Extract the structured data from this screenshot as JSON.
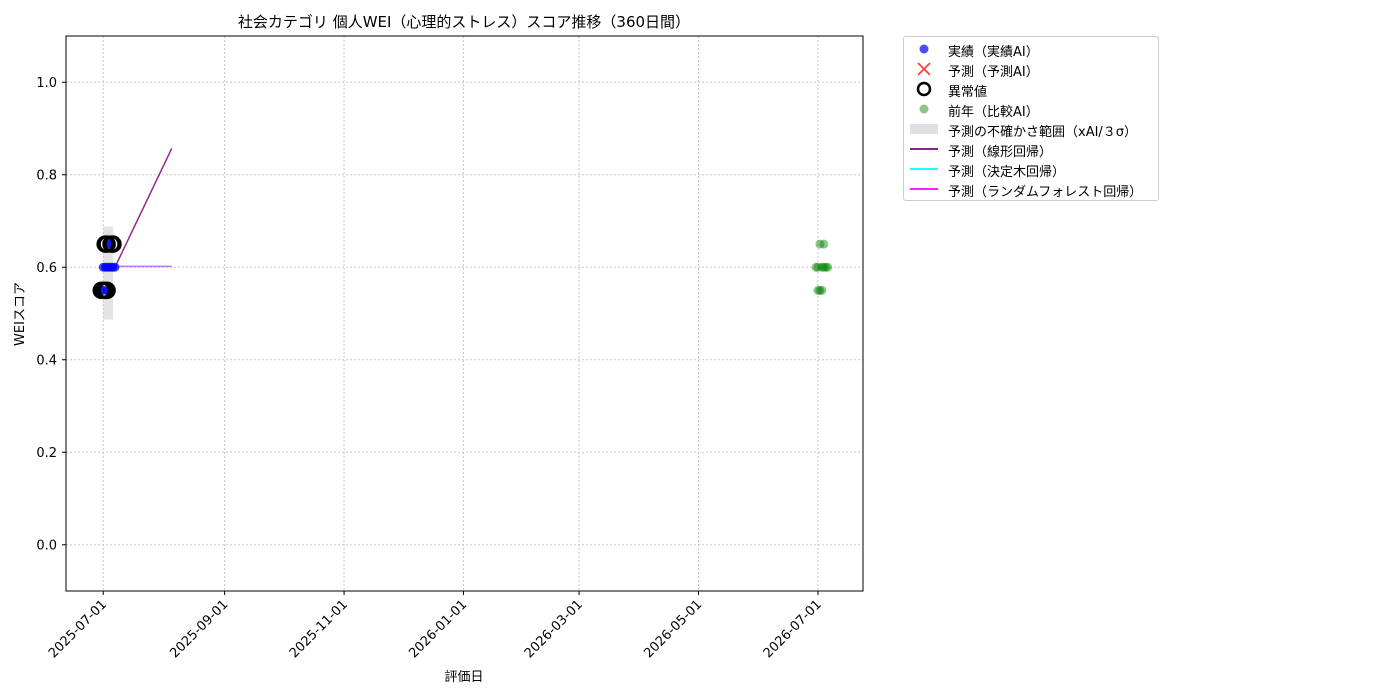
{
  "chart_data": {
    "type": "scatter",
    "title": "社会カテゴリ 個人WEI（心理的ストレス）スコア推移（360日間）",
    "xlabel": "評価日",
    "ylabel": "WEIスコア",
    "xlim": [
      "2025-06-12",
      "2026-07-24"
    ],
    "ylim": [
      -0.1,
      1.1
    ],
    "xticks": [
      "2025-07-01",
      "2025-09-01",
      "2025-11-01",
      "2026-01-01",
      "2026-03-01",
      "2026-05-01",
      "2026-07-01"
    ],
    "yticks": [
      "0.0",
      "0.2",
      "0.4",
      "0.6",
      "0.8",
      "1.0"
    ],
    "grid": true,
    "legend_position": "outside-top-right",
    "series": [
      {
        "name": "実績（実績AI）",
        "kind": "scatter",
        "color": "#0000ff",
        "points": [
          [
            "2025-06-30",
            0.55
          ],
          [
            "2025-07-01",
            0.55
          ],
          [
            "2025-07-01",
            0.6
          ],
          [
            "2025-07-02",
            0.6
          ],
          [
            "2025-07-03",
            0.6
          ],
          [
            "2025-07-03",
            0.55
          ],
          [
            "2025-07-04",
            0.6
          ],
          [
            "2025-07-04",
            0.65
          ],
          [
            "2025-07-05",
            0.6
          ],
          [
            "2025-07-05",
            0.65
          ],
          [
            "2025-07-06",
            0.6
          ],
          [
            "2025-07-07",
            0.6
          ]
        ]
      },
      {
        "name": "予測（予測AI）",
        "kind": "x-marker",
        "color": "#ff0000",
        "points": []
      },
      {
        "name": "異常値",
        "kind": "ring",
        "color": "#000000",
        "points": [
          [
            "2025-06-30",
            0.55
          ],
          [
            "2025-07-01",
            0.55
          ],
          [
            "2025-07-02",
            0.55
          ],
          [
            "2025-07-03",
            0.55
          ],
          [
            "2025-07-02",
            0.65
          ],
          [
            "2025-07-03",
            0.65
          ],
          [
            "2025-07-05",
            0.65
          ],
          [
            "2025-07-06",
            0.65
          ]
        ]
      },
      {
        "name": "前年（比較AI）",
        "kind": "scatter-faded",
        "color": "#008000",
        "points": [
          [
            "2026-06-30",
            0.6
          ],
          [
            "2026-07-01",
            0.6
          ],
          [
            "2026-07-01",
            0.55
          ],
          [
            "2026-07-02",
            0.55
          ],
          [
            "2026-07-03",
            0.55
          ],
          [
            "2026-07-02",
            0.65
          ],
          [
            "2026-07-04",
            0.65
          ],
          [
            "2026-07-03",
            0.6
          ],
          [
            "2026-07-04",
            0.6
          ],
          [
            "2026-07-05",
            0.6
          ],
          [
            "2026-07-06",
            0.6
          ]
        ]
      },
      {
        "name": "予測の不確かさ範囲（xAI/３σ）",
        "kind": "band",
        "color": "#cccccc",
        "x": [
          "2025-07-01",
          "2025-07-06"
        ],
        "ymin": 0.487,
        "ymax": 0.688
      },
      {
        "name": "予測（線形回帰）",
        "kind": "line",
        "color": "#800080",
        "points": [
          [
            "2025-07-07",
            0.6
          ],
          [
            "2025-08-05",
            0.857
          ]
        ]
      },
      {
        "name": "予測（決定木回帰）",
        "kind": "line",
        "color": "#00ffff",
        "points": [
          [
            "2025-07-01",
            0.602
          ],
          [
            "2025-08-05",
            0.602
          ]
        ]
      },
      {
        "name": "予測（ランダムフォレスト回帰）",
        "kind": "line",
        "color": "#ff00ff",
        "points": [
          [
            "2025-07-01",
            0.602
          ],
          [
            "2025-08-05",
            0.602
          ]
        ]
      }
    ]
  }
}
